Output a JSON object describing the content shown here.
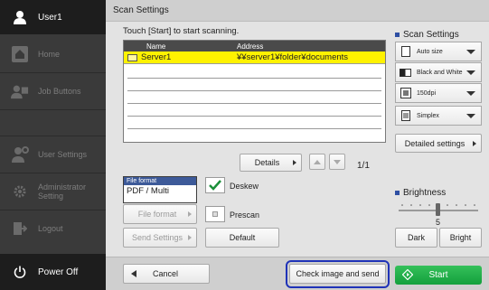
{
  "sidebar": {
    "user": "User1",
    "items": [
      {
        "label": "Home",
        "icon": "home-icon"
      },
      {
        "label": "Job Buttons",
        "icon": "job-buttons-icon"
      },
      {
        "label": "User Settings",
        "icon": "user-settings-icon"
      },
      {
        "label": "Administrator Setting",
        "icon": "admin-gear-icon"
      },
      {
        "label": "Logout",
        "icon": "logout-icon"
      }
    ],
    "power": "Power Off"
  },
  "main": {
    "title": "Scan Settings",
    "instruction": "Touch [Start] to start scanning.",
    "table": {
      "columns": [
        "Name",
        "Address"
      ],
      "rows": [
        {
          "name": "Server1",
          "address": "¥¥server1¥folder¥documents",
          "selected": true
        }
      ]
    },
    "details_label": "Details",
    "page_indicator": "1/1",
    "file_format": {
      "title": "File format",
      "value": "PDF / Multi"
    },
    "deskew_label": "Deskew",
    "file_format_button": "File format",
    "prescan_label": "Prescan",
    "send_settings_button": "Send Settings",
    "default_button": "Default",
    "cancel_button": "Cancel",
    "check_send_button": "Check image and send",
    "start_button": "Start"
  },
  "right_panel": {
    "scan_settings_title": "Scan Settings",
    "dropdowns": [
      {
        "label": "Auto size",
        "icon": "paper-size-icon"
      },
      {
        "label": "Black and White",
        "icon": "color-mode-icon"
      },
      {
        "label": "150dpi",
        "icon": "resolution-icon"
      },
      {
        "label": "Simplex",
        "icon": "simplex-icon"
      }
    ],
    "detailed_settings": "Detailed settings",
    "brightness_title": "Brightness",
    "brightness_value": "5",
    "dark_button": "Dark",
    "bright_button": "Bright"
  },
  "colors": {
    "accent": "#2e4fa3",
    "selected_row": "#fff200",
    "start_green": "#13a03c",
    "focus_ring": "#1f33b8"
  }
}
